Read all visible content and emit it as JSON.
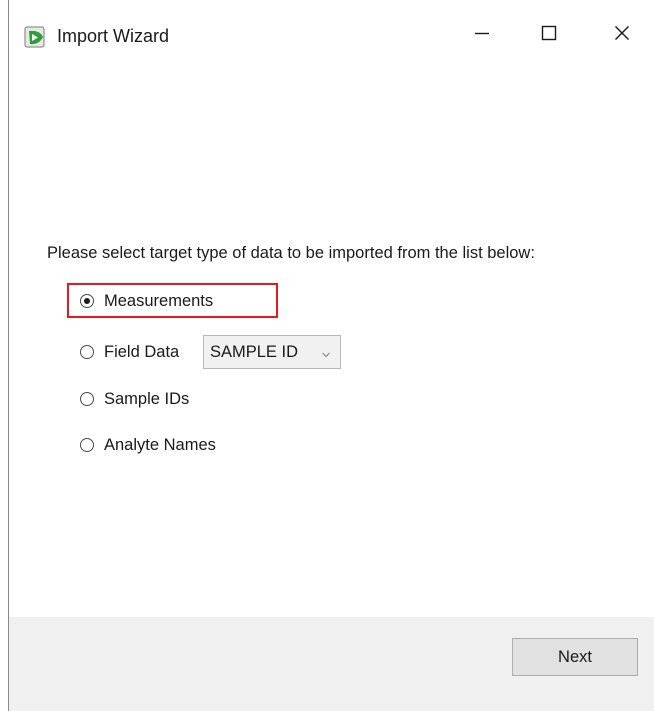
{
  "window": {
    "title": "Import Wizard",
    "icon": "import-wizard-app-icon",
    "controls": {
      "minimize_icon": "minimize-icon",
      "maximize_icon": "maximize-icon",
      "close_icon": "close-icon"
    }
  },
  "main": {
    "prompt": "Please select target type of data to be imported from the list below:",
    "options": [
      {
        "label": "Measurements",
        "selected": true,
        "highlighted": true
      },
      {
        "label": "Field Data",
        "selected": false
      },
      {
        "label": "Sample IDs",
        "selected": false
      },
      {
        "label": "Analyte Names",
        "selected": false
      }
    ],
    "field_data_select": {
      "value": "SAMPLE ID",
      "icon": "chevron-down-icon"
    }
  },
  "footer": {
    "next_label": "Next"
  },
  "colors": {
    "highlight_border": "#e11b22",
    "footer_background": "#f0f0f0",
    "button_background": "#e1e1e1",
    "app_icon_green": "#2e9e3a"
  }
}
